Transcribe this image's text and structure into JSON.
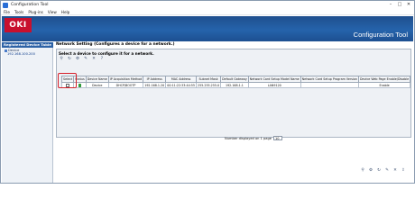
{
  "window": {
    "title": "Configuration Tool",
    "controls": [
      "–",
      "□",
      "✕"
    ]
  },
  "menu": {
    "items": [
      "File",
      "Tools",
      "Plug-ins",
      "View",
      "Help"
    ]
  },
  "banner": {
    "logo": "OKI",
    "product": "Configuration Tool",
    "brand_color": "#c8102e"
  },
  "sidebar": {
    "header": "Registered Device Table",
    "tree": {
      "root": "Device",
      "child": "192.168.100.200"
    }
  },
  "main": {
    "title": "Network Setting (Configures a device for a network.)",
    "panel_heading": "Select a device to configure it for a network.",
    "tools": [
      "search-icon",
      "refresh-icon",
      "settings-icon",
      "edit-icon",
      "delete-icon",
      "help-icon"
    ],
    "table": {
      "headers": [
        "Select",
        "Status",
        "Device Name",
        "IP Acquisition Method",
        "IP Address",
        "MAC Address",
        "Subnet Mask",
        "Default Gateway",
        "Network Card Setup Model Name",
        "Network Card Setup Program Version",
        "Device Web Page Enable/Disable"
      ],
      "rows": [
        [
          "",
          "",
          "Device",
          "DHCP/BOOTP",
          "192.168.1.20",
          "00:11:22:33:44:55",
          "255.255.255.0",
          "192.168.1.1",
          "LAN9120",
          "",
          "Enable"
        ]
      ]
    },
    "pager": {
      "label": "Number displayed on 1 page",
      "value": "10"
    },
    "bottom_tools": [
      "search-icon",
      "settings-icon",
      "refresh-icon",
      "edit-icon",
      "delete-icon",
      "export-icon"
    ]
  }
}
